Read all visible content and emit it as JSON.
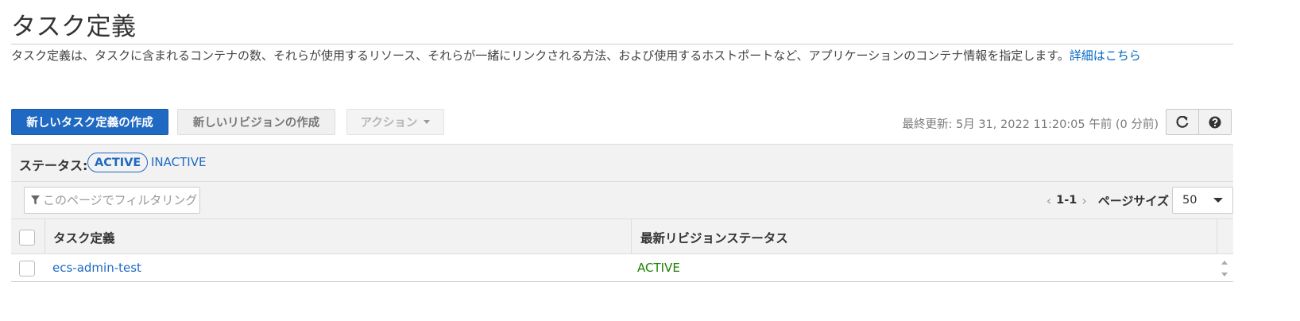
{
  "header": {
    "title": "タスク定義",
    "description": "タスク定義は、タスクに含まれるコンテナの数、それらが使用するリソース、それらが一緒にリンクされる方法、および使用するホストポートなど、アプリケーションのコンテナ情報を指定します。",
    "learn_more_link": "詳細はこちら"
  },
  "toolbar": {
    "create_button": "新しいタスク定義の作成",
    "new_revision_button": "新しいリビジョンの作成",
    "actions_button": "アクション",
    "last_updated": "最終更新: 5月 31, 2022 11:20:05 午前 (0 分前)",
    "refresh_icon": "refresh-icon",
    "help_icon": "question-circle-icon"
  },
  "status_filter": {
    "label": "ステータス:",
    "active": "ACTIVE",
    "inactive": "INACTIVE"
  },
  "filter": {
    "placeholder": "このページでフィルタリング",
    "icon": "filter-icon"
  },
  "pagination": {
    "range": "1-1",
    "page_size_label": "ページサイズ",
    "page_size": "50"
  },
  "table": {
    "columns": [
      "タスク定義",
      "最新リビジョンステータス"
    ],
    "rows": [
      {
        "name": "ecs-admin-test",
        "status": "ACTIVE"
      }
    ]
  },
  "colors": {
    "primary": "#1f69c3",
    "link": "#1f69c3",
    "status_active": "#1d8102"
  }
}
